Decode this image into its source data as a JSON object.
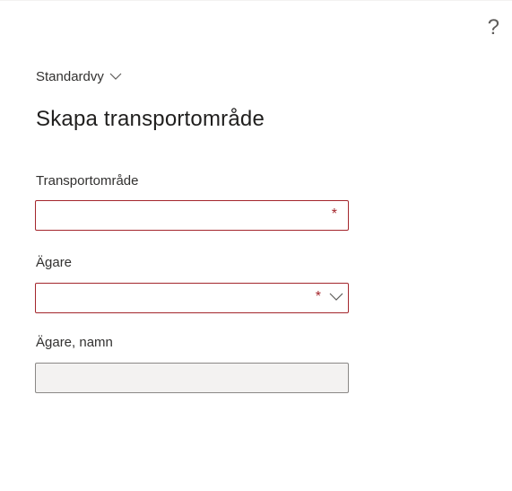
{
  "header": {
    "help_symbol": "?",
    "view_name": "Standardvy"
  },
  "page": {
    "title": "Skapa transportområde"
  },
  "fields": {
    "transport_area": {
      "label": "Transportområde",
      "value": "",
      "required_mark": "*"
    },
    "owner": {
      "label": "Ägare",
      "value": "",
      "required_mark": "*"
    },
    "owner_name": {
      "label": "Ägare, namn",
      "value": ""
    }
  },
  "colors": {
    "required": "#a4262c",
    "readonly_bg": "#f3f2f1"
  }
}
